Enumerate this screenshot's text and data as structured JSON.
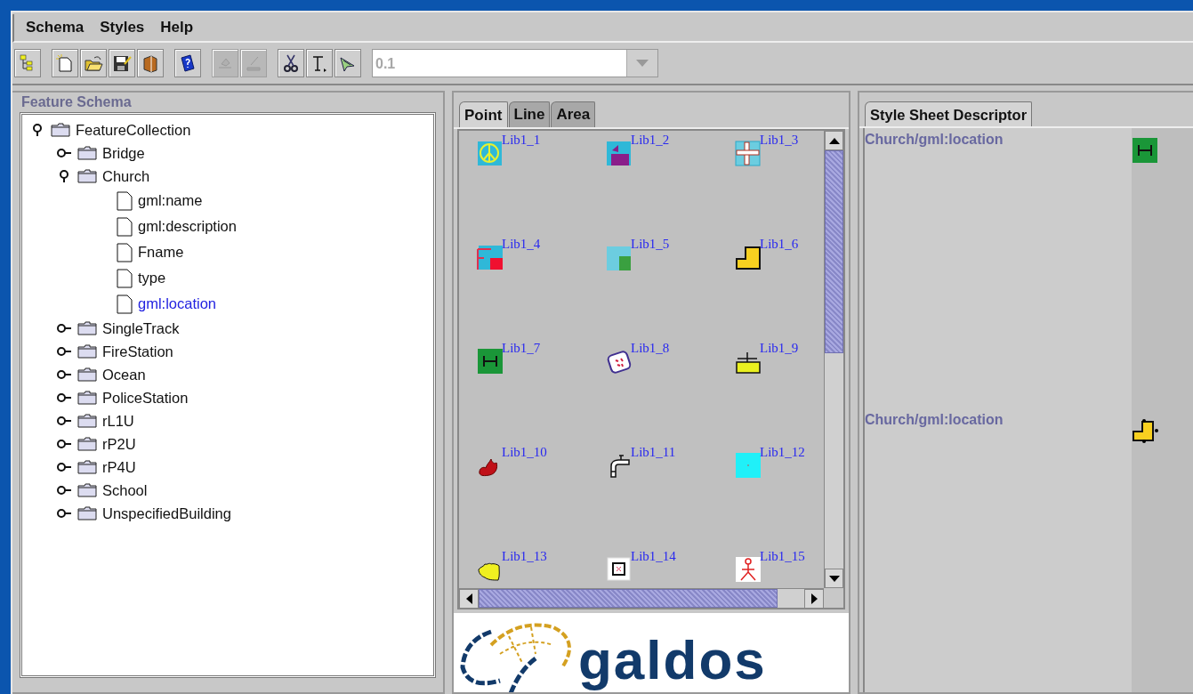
{
  "menu": [
    {
      "label": "Schema"
    },
    {
      "label": "Styles"
    },
    {
      "label": "Help"
    }
  ],
  "toolbar": {
    "buttons": [
      {
        "kind": "tree",
        "disabled": false
      },
      {
        "kind": "new",
        "disabled": false
      },
      {
        "kind": "open",
        "disabled": false
      },
      {
        "kind": "save",
        "disabled": false
      },
      {
        "kind": "book",
        "disabled": false
      },
      {
        "kind": "help",
        "disabled": false
      },
      {
        "kind": "paint",
        "disabled": true
      },
      {
        "kind": "pen",
        "disabled": true
      },
      {
        "kind": "cut",
        "disabled": false
      },
      {
        "kind": "text",
        "disabled": false
      },
      {
        "kind": "pointer",
        "disabled": false
      }
    ],
    "combo": {
      "value": "0.1",
      "disabled": true
    }
  },
  "feature_schema": {
    "title": "Feature Schema",
    "tree": [
      {
        "label": "FeatureCollection",
        "expanded": true,
        "selected": false,
        "children": [
          {
            "label": "Bridge",
            "expanded": false,
            "selected": false
          },
          {
            "label": "Church",
            "expanded": true,
            "selected": false,
            "children": [
              {
                "label": "gml:name",
                "selected": false
              },
              {
                "label": "gml:description",
                "selected": false
              },
              {
                "label": "Fname",
                "selected": false
              },
              {
                "label": "type",
                "selected": false
              },
              {
                "label": "gml:location",
                "selected": true
              }
            ]
          },
          {
            "label": "SingleTrack",
            "expanded": false,
            "selected": false
          },
          {
            "label": "FireStation",
            "expanded": false,
            "selected": false
          },
          {
            "label": "Ocean",
            "expanded": false,
            "selected": false
          },
          {
            "label": "PoliceStation",
            "expanded": false,
            "selected": false
          },
          {
            "label": "rL1U",
            "expanded": false,
            "selected": false
          },
          {
            "label": "rP2U",
            "expanded": false,
            "selected": false
          },
          {
            "label": "rP4U",
            "expanded": false,
            "selected": false
          },
          {
            "label": "School",
            "expanded": false,
            "selected": false
          },
          {
            "label": "UnspecifiedBuilding",
            "expanded": false,
            "selected": false
          }
        ]
      }
    ]
  },
  "palette": {
    "tabs": [
      {
        "label": "Point",
        "selected": true
      },
      {
        "label": "Line",
        "selected": false
      },
      {
        "label": "Area",
        "selected": false
      }
    ],
    "symbols": [
      {
        "label": "Lib1_1",
        "kind": "peace"
      },
      {
        "label": "Lib1_2",
        "kind": "flag"
      },
      {
        "label": "Lib1_3",
        "kind": "cross"
      },
      {
        "label": "Lib1_4",
        "kind": "corner"
      },
      {
        "label": "Lib1_5",
        "kind": "split"
      },
      {
        "label": "Lib1_6",
        "kind": "step"
      },
      {
        "label": "Lib1_7",
        "kind": "hbar"
      },
      {
        "label": "Lib1_8",
        "kind": "dice"
      },
      {
        "label": "Lib1_9",
        "kind": "plusbox"
      },
      {
        "label": "Lib1_10",
        "kind": "flame"
      },
      {
        "label": "Lib1_11",
        "kind": "faucet"
      },
      {
        "label": "Lib1_12",
        "kind": "cyan"
      },
      {
        "label": "Lib1_13",
        "kind": "blob"
      },
      {
        "label": "Lib1_14",
        "kind": "xbox"
      },
      {
        "label": "Lib1_15",
        "kind": "figure"
      }
    ],
    "logo": "galdos"
  },
  "style_sheet": {
    "tabs": [
      {
        "label": "Style Sheet Descriptor",
        "selected": true
      }
    ],
    "entries": [
      {
        "path": "Church/gml:location",
        "kind": "hbar"
      },
      {
        "path": "Church/gml:location",
        "kind": "stepdots"
      }
    ]
  }
}
